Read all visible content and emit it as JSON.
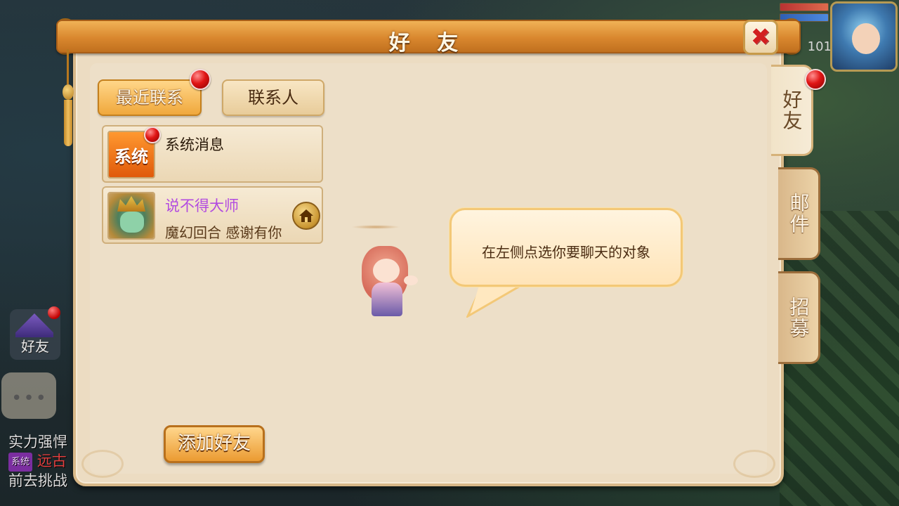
{
  "window": {
    "title": "好 友"
  },
  "hud": {
    "level": "101"
  },
  "tabs": {
    "recent": "最近联系",
    "contacts": "联系人"
  },
  "contacts": [
    {
      "icon_text": "系统",
      "name": "系统消息",
      "sub": "",
      "has_dot": true
    },
    {
      "icon_text": "",
      "name": "说不得大师",
      "sub": "魔幻回合  感谢有你",
      "has_dot": false,
      "name_color": "#b24be0"
    }
  ],
  "bubble": {
    "text": "在左侧点选你要聊天的对象"
  },
  "side_tabs": [
    "好友",
    "邮件",
    "招募"
  ],
  "buttons": {
    "add_friend": "添加好友",
    "close": "✖"
  },
  "left_hud": {
    "friend_label": "好友",
    "chat_dots": "•••",
    "chat_line1": "实力强悍",
    "chat_sys_tag": "系统",
    "chat_line2_red": "远古",
    "chat_line3": "前去挑战"
  },
  "colors": {
    "accent_orange": "#e0922e",
    "badge_red": "#e01515",
    "player_name": "#b24be0"
  }
}
